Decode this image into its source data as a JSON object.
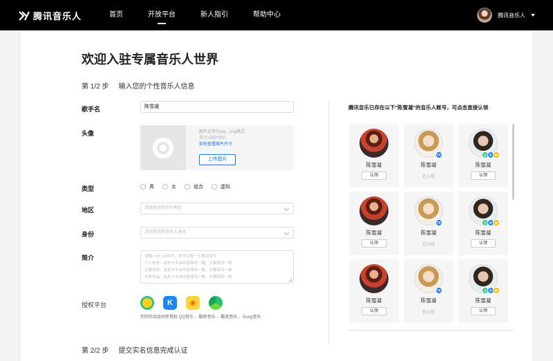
{
  "topbar": {
    "logo_text": "腾讯音乐人",
    "nav": [
      {
        "label": "首页",
        "active": false
      },
      {
        "label": "开放平台",
        "active": true
      },
      {
        "label": "新人指引",
        "active": false
      },
      {
        "label": "帮助中心",
        "active": false
      }
    ],
    "user_name": "腾讯音乐人"
  },
  "page": {
    "title": "欢迎入驻专属音乐人世界",
    "step1": {
      "number": "第 1/2 步",
      "text": "输入您的个性音乐人信息"
    },
    "step2": {
      "number": "第 2/2 步",
      "text": "提交实名信息完成认证"
    }
  },
  "form": {
    "singer_name": {
      "label": "歌手名",
      "value": "陈雪凝"
    },
    "avatar": {
      "label": "头像",
      "hint1": "图片必须为jpg、png格式",
      "hint2": "尺寸>500*500",
      "link": "如何查看图片尺寸",
      "button": "上传图片"
    },
    "type": {
      "label": "类型",
      "options": [
        "男",
        "女",
        "组合",
        "虚拟"
      ]
    },
    "region": {
      "label": "地区",
      "placeholder": "请选择你的所在地区"
    },
    "identity": {
      "label": "身份",
      "placeholder": "请选择你的音乐人身份"
    },
    "intro": {
      "label": "简介",
      "lines": [
        "请输入50~2000字，你可以按一下格式填写:",
        "个人信息：此处与平台内容保持一致，文案保持一致",
        "主要成就：此处与平台内容保持一致，文案保持一致",
        "代表作品：此处与平台内容保持一致，文案保持一致"
      ]
    },
    "platforms": {
      "label": "授权平台",
      "note": "你的作品会同步授权 QQ音乐 、酷狗音乐 、酷我音乐 、5sing音乐",
      "icons": [
        "qq-music-icon",
        "kugou-icon",
        "kuwo-icon",
        "5sing-icon"
      ]
    }
  },
  "right_panel": {
    "title": "腾讯音乐已存在以下\"陈雪凝\"的音乐人账号，可点击直接认领",
    "rows": [
      [
        {
          "name": "陈雪凝",
          "action": "认领",
          "face": "a",
          "badges": []
        },
        {
          "name": "陈雪凝",
          "status": "已入驻",
          "face": "b",
          "badges": [
            "tme"
          ]
        },
        {
          "name": "陈雪凝",
          "action": "认领",
          "face": "c",
          "badges": [
            "q",
            "k",
            "w"
          ]
        }
      ],
      [
        {
          "name": "陈雪凝",
          "action": "认领",
          "face": "a",
          "badges": []
        },
        {
          "name": "陈雪凝",
          "status": "已入驻",
          "face": "b",
          "badges": [
            "tme"
          ]
        },
        {
          "name": "陈雪凝",
          "action": "认领",
          "face": "c",
          "badges": [
            "q",
            "k",
            "w"
          ]
        }
      ],
      [
        {
          "name": "陈雪凝",
          "action": "认领",
          "face": "a",
          "badges": []
        },
        {
          "name": "陈雪凝",
          "status": "已入驻",
          "face": "b",
          "badges": [
            "tme"
          ]
        },
        {
          "name": "陈雪凝",
          "action": "认领",
          "face": "c",
          "badges": [
            "q",
            "k",
            "w"
          ]
        }
      ]
    ]
  }
}
